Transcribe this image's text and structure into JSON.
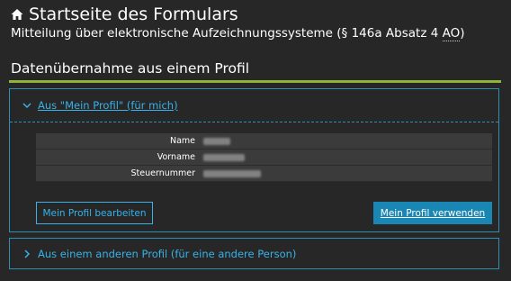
{
  "header": {
    "title": "Startseite des Formulars",
    "subtitle_prefix": "Mitteilung über elektronische Aufzeichnungssysteme (§ 146a Absatz 4 ",
    "subtitle_abbr": "AO",
    "subtitle_suffix": ")"
  },
  "section": {
    "heading": "Datenübernahme aus einem Profil",
    "accent_color": "#8fb43a"
  },
  "panel_own": {
    "title": "Aus \"Mein Profil\" (für mich)",
    "expanded": true,
    "rows": [
      {
        "label": "Name"
      },
      {
        "label": "Vorname"
      },
      {
        "label": "Steuernummer"
      }
    ],
    "edit_button": "Mein Profil bearbeiten",
    "use_button": "Mein Profil verwenden"
  },
  "panel_other": {
    "title": "Aus einem anderen Profil (für eine andere Person)",
    "expanded": false
  },
  "colors": {
    "background": "#272727",
    "link": "#38b2e8",
    "primary_button": "#1a86b4",
    "panel_border": "#2e8fb5"
  }
}
